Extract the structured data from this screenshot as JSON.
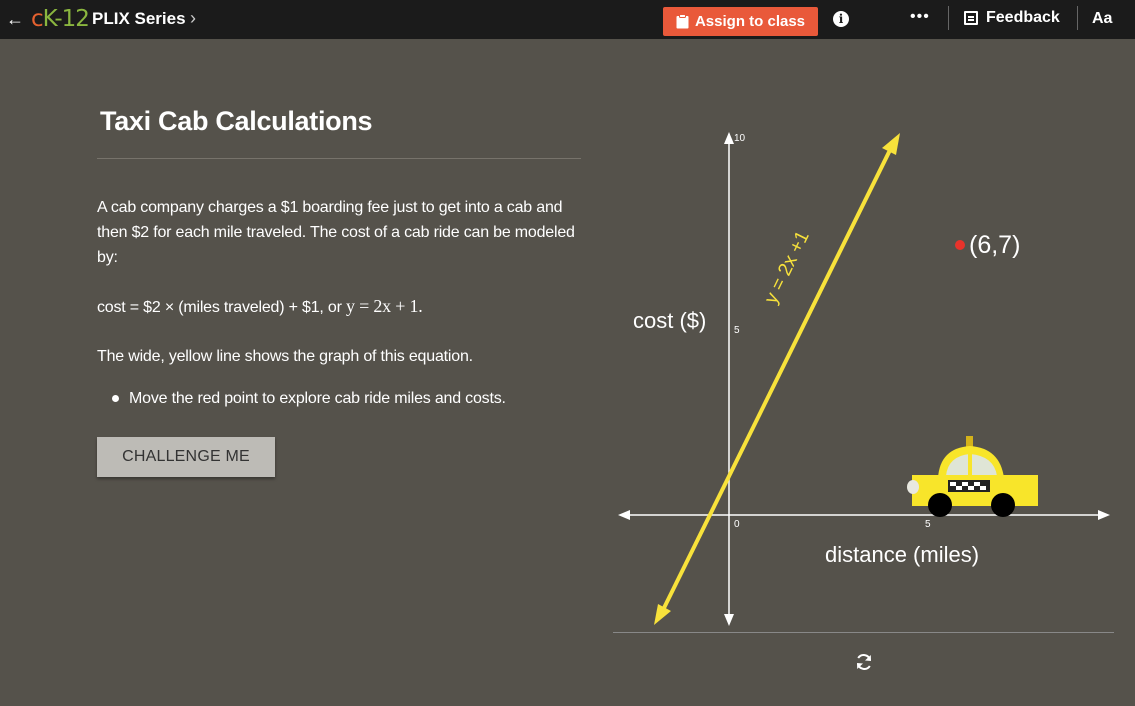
{
  "topbar": {
    "back_icon": "arrow-left-icon",
    "logo_c": "c",
    "logo_k12": "K-12",
    "series_label": "PLIX Series",
    "series_chevron": "›",
    "assign_label": "Assign to class",
    "assign_icon": "clipboard-icon",
    "info_icon": "info-icon",
    "more_label": "•••",
    "feedback_label": "Feedback",
    "font_size_label": "Aa",
    "assign_color": "#e9593a"
  },
  "lesson": {
    "title": "Taxi Cab Calculations",
    "paragraph1": "A cab company charges a $1 boarding fee just to get into a cab and then $2 for each mile traveled.  The cost of a cab ride can be modeled by:",
    "paragraph2_prefix": "cost = $2 × (miles traveled) + $1, or ",
    "equation_math": "y = 2x + 1.",
    "paragraph3": "The wide, yellow line shows the graph of this equation.",
    "bullet": "Move the red point to explore cab ride miles and costs.",
    "challenge_label": "CHALLENGE ME"
  },
  "graph": {
    "y_axis_label": "cost ($)",
    "x_axis_label": "distance (miles)",
    "line_label": "y = 2x +1",
    "point_label": "(6,7)",
    "tick_y_top": "10",
    "tick_y_mid": "5",
    "tick_x_mid": "5",
    "tick_origin": "0",
    "line_color": "#f8e23b",
    "point_color": "#e8332b",
    "refresh_icon": "refresh-icon"
  }
}
